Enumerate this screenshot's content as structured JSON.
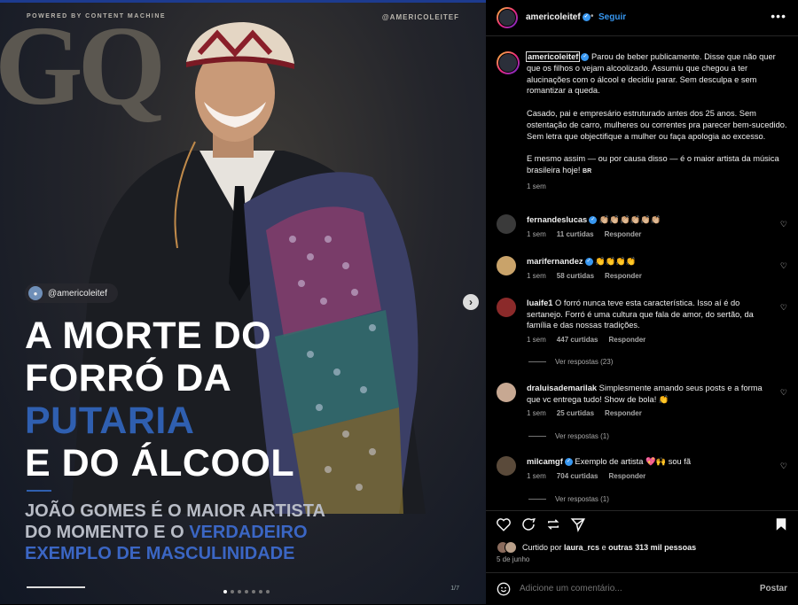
{
  "post": {
    "powered": "POWERED BY CONTENT MACHINE",
    "handle_top": "@AMERICOLEITEF",
    "logo": "GQ",
    "tag": "@americoleitef",
    "headline_l1": "A MORTE DO",
    "headline_l2": "FORRÓ DA",
    "headline_l3": "PUTARIA",
    "headline_l4": "E DO ÁLCOOL",
    "sub_l1": "JOÃO GOMES É O MAIOR ARTISTA",
    "sub_l2a": "DO MOMENTO E O ",
    "sub_l2b": "VERDADEIRO",
    "sub_l3": "EXEMPLO DE MASCULINIDADE",
    "pager": "1/7",
    "slide_index": 1,
    "slide_count": 7
  },
  "header": {
    "username": "americoleitef",
    "follow": "Seguir",
    "more": "•••"
  },
  "caption": {
    "username": "americoleitef",
    "p1": "Parou de beber publicamente. Disse que não quer que os filhos o vejam alcoolizado. Assumiu que chegou a ter alucinações com o álcool e decidiu parar. Sem desculpa e sem romantizar a queda.",
    "p2": "Casado, pai e empresário estruturado antes dos 25 anos. Sem ostentação de carro, mulheres ou correntes pra parecer bem-sucedido. Sem letra que objectifique a mulher ou faça apologia ao excesso.",
    "p3": "E mesmo assim — ou por causa disso — é o maior artista da música brasileira hoje! ",
    "flag": "BR",
    "time": "1 sem"
  },
  "comments": [
    {
      "user": "fernandeslucas",
      "text": "👏🏼👏🏼👏🏼👏🏼👏🏼👏🏼",
      "time": "1 sem",
      "likes": "11 curtidas",
      "reply": "Responder",
      "verified": true,
      "avatar_color": "#3a3a3a"
    },
    {
      "user": "marifernandez",
      "text": "👏👏👏👏",
      "time": "1 sem",
      "likes": "58 curtidas",
      "reply": "Responder",
      "verified": true,
      "avatar_color": "#c9a36a"
    },
    {
      "user": "luaife1",
      "text": "O forró nunca teve esta característica. Isso aí é do sertanejo. Forró é uma cultura que fala de amor, do sertão, da família e das nossas tradições.",
      "time": "1 sem",
      "likes": "447 curtidas",
      "reply": "Responder",
      "verified": false,
      "avatar_color": "#8b2a2a",
      "replies": "Ver respostas (23)"
    },
    {
      "user": "draluisademarilak",
      "text": "Simplesmente amando seus posts e a forma que vc entrega tudo! Show de bola! 👏",
      "time": "1 sem",
      "likes": "25 curtidas",
      "reply": "Responder",
      "verified": false,
      "avatar_color": "#c7a892",
      "replies": "Ver respostas (1)"
    },
    {
      "user": "milcamgf",
      "text": "Exemplo de artista 💖🙌 sou fã",
      "time": "1 sem",
      "likes": "704 curtidas",
      "reply": "Responder",
      "verified": true,
      "avatar_color": "#5a4a3a",
      "replies": "Ver respostas (1)"
    }
  ],
  "liked": {
    "prefix": "Curtido por ",
    "user": "laura_rcs",
    "middle": " e ",
    "others": "outras 313 mil pessoas"
  },
  "date": "5 de junho",
  "compose": {
    "placeholder": "Adicione um comentário...",
    "post": "Postar"
  }
}
